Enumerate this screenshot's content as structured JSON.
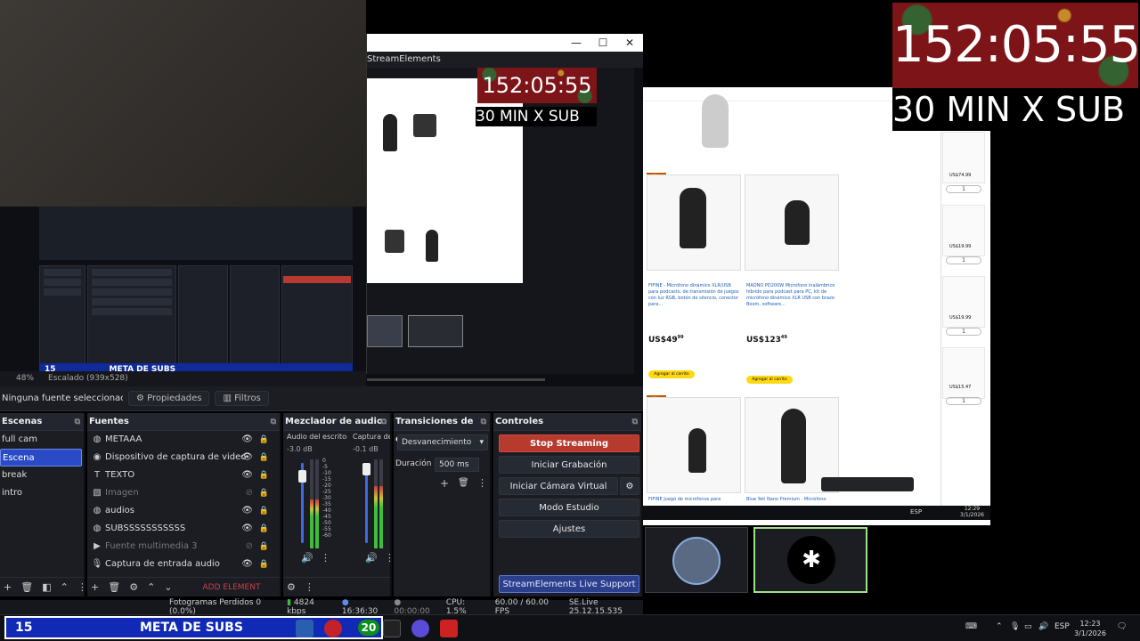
{
  "timer": {
    "value": "152:05:55",
    "subtitle": "30 MIN X SUB"
  },
  "obs_window": {
    "title_fragment": "StreamElements",
    "controls": [
      "—",
      "☐",
      "✕"
    ]
  },
  "zoom_bar": {
    "zoom": "48%",
    "scaled": "Escalado (939x528)"
  },
  "toolbar": {
    "no_source": "Ninguna fuente seleccionac",
    "properties": "Propiedades",
    "filters": "Filtros"
  },
  "scenes": {
    "title": "Escenas",
    "items": [
      "full cam",
      "Escena",
      "break",
      "intro"
    ],
    "active_index": 1
  },
  "sources": {
    "title": "Fuentes",
    "items": [
      {
        "label": "METAAA",
        "icon": "globe-icon",
        "visible": true
      },
      {
        "label": "Dispositivo de captura de video",
        "icon": "camera-icon",
        "visible": true
      },
      {
        "label": "TEXTO",
        "icon": "text-icon",
        "visible": true
      },
      {
        "label": "Imagen",
        "icon": "image-icon",
        "visible": false
      },
      {
        "label": "audios",
        "icon": "globe-icon",
        "visible": true
      },
      {
        "label": "SUBSSSSSSSSSSS",
        "icon": "globe-icon",
        "visible": true
      },
      {
        "label": "Fuente multimedia 3",
        "icon": "play-icon",
        "visible": false
      },
      {
        "label": "Captura de entrada audio",
        "icon": "mic-icon",
        "visible": true
      }
    ],
    "add_element": "ADD ELEMENT"
  },
  "mixer": {
    "title": "Mezclador de audio",
    "channels": [
      {
        "name": "Audio del escritorio",
        "db": "-3.0 dB",
        "level": 0.55
      },
      {
        "name": "Captura de e",
        "db": "-0.1 dB",
        "level": 0.7
      }
    ],
    "scale": [
      "0",
      "-5",
      "-10",
      "-15",
      "-20",
      "-25",
      "-30",
      "-35",
      "-40",
      "-45",
      "-50",
      "-55",
      "-60"
    ]
  },
  "transitions": {
    "title": "Transiciones de e...",
    "selected": "Desvanecimiento",
    "duration_label": "Duración",
    "duration_value": "500 ms"
  },
  "controls": {
    "title": "Controles",
    "stop_streaming": "Stop Streaming",
    "start_recording": "Iniciar Grabación",
    "virtual_cam": "Iniciar Cámara Virtual",
    "studio_mode": "Modo Estudio",
    "settings": "Ajustes",
    "support": "StreamElements Live Support"
  },
  "statusbar": {
    "dropped": "Fotogramas Perdidos 0 (0.0%)",
    "bitrate": "4824 kbps",
    "live_time": "16:36:30",
    "rec_time": "00:00:00",
    "cpu": "CPU: 1.5%",
    "fps": "60.00 / 60.00 FPS",
    "version": "SE.Live 25.12.15.535"
  },
  "amazon": {
    "products": [
      {
        "title": "FIFINE - Micrófono dinámico XLR/USB para podcasts, de transmisión de juegos con luz RGB, botón de silencio, conector para...",
        "price": "49",
        "cents": "99",
        "badge": "Más vendido",
        "cart": "Agregar al carrito"
      },
      {
        "title": "MAONO PD200W Micrófono inalámbrico híbrido para podcast para PC, kit de micrófono dinámico XLR USB con brazo Boom, software...",
        "price": "123",
        "cents": "49",
        "badge": "",
        "cart": "Agregar al carrito"
      },
      {
        "title": "FIFINE Juego de micrófonos para",
        "price": "",
        "cents": "",
        "badge": "Más vendido",
        "cart": ""
      },
      {
        "title": "Blue Yeti Nano Premium - Micrófono",
        "price": "",
        "cents": "",
        "badge": "",
        "cart": ""
      }
    ],
    "side_prices": [
      "US$74.99",
      "US$19.99",
      "US$19.99",
      "US$15.47"
    ],
    "side_qty": "1"
  },
  "right_tray": {
    "lang": "ESP",
    "time": "12:29",
    "date": "3/1/2026"
  },
  "subgoal": {
    "current": "15",
    "label": "META DE SUBS",
    "goal": "20"
  },
  "taskbar": {
    "lang": "ESP",
    "time": "12:23",
    "date": "3/1/2026"
  }
}
